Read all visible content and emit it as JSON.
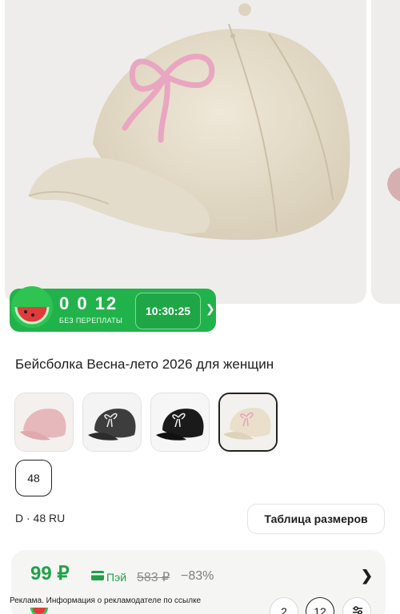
{
  "product": {
    "title": "Бейсболка  Весна-лето 2026 для женщин",
    "image_alt": "beige baseball cap with pink bow"
  },
  "promo": {
    "digits": "0 0 12",
    "subtitle": "БЕЗ ПЕРЕПЛАТЫ",
    "timer": "10:30:25"
  },
  "variants": [
    {
      "color": "#e8bcbc",
      "selected": false
    },
    {
      "color": "#3a3a3a",
      "selected": false
    },
    {
      "color": "#161616",
      "selected": false
    },
    {
      "color": "#ece1cd",
      "selected": true
    }
  ],
  "sizes": {
    "selected_chip": "48",
    "line": "D · 48 RU",
    "table_button": "Таблица размеров"
  },
  "price": {
    "current": "99 ₽",
    "pay_label": "Пэй",
    "old": "583 ₽",
    "discount": "−83%"
  },
  "ad_note": "Реклама. Информация о рекламодателе по ссылке",
  "quantity_chips": [
    "2",
    "12"
  ],
  "colors": {
    "accent_green": "#22b24c",
    "price_green": "#22a04a"
  }
}
